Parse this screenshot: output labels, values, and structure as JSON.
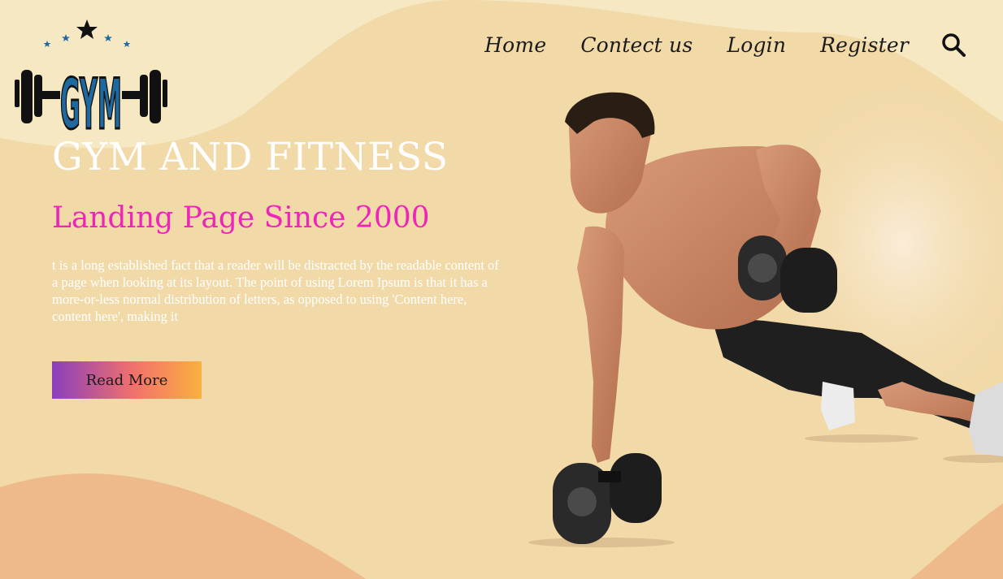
{
  "logo": {
    "text": "GYM"
  },
  "nav": {
    "items": [
      {
        "label": "Home"
      },
      {
        "label": "Contect us"
      },
      {
        "label": "Login"
      },
      {
        "label": "Register"
      }
    ],
    "search_icon": "search-icon"
  },
  "hero": {
    "title": "GYM AND FITNESS",
    "subtitle": "Landing Page Since 2000",
    "body": "t is a long established fact that a reader will be distracted by the readable content of a page when looking at its layout. The point of using Lorem Ipsum is that it has a more-or-less normal distribution of letters, as opposed to using 'Content here, content here', making it",
    "button_label": "Read More"
  },
  "colors": {
    "background": "#f1d9a8",
    "subtitle": "#ee25b8",
    "logo_blue": "#1e6aa0",
    "button_gradient": [
      "#8a3fbd",
      "#f2716b",
      "#fbb040"
    ]
  }
}
